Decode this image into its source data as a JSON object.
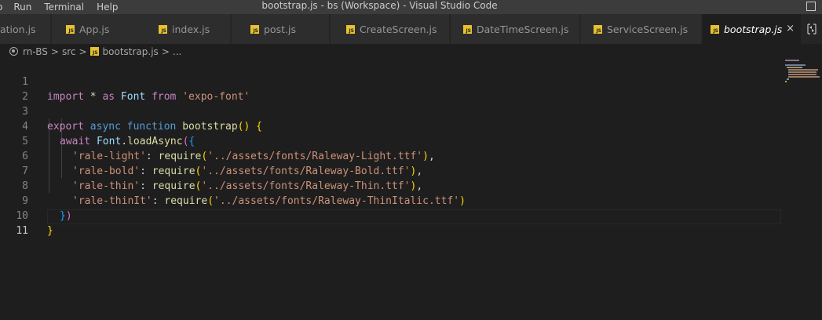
{
  "window": {
    "title": "bootstrap.js - bs (Workspace) - Visual Studio Code",
    "menu": [
      "o",
      "Run",
      "Terminal",
      "Help"
    ]
  },
  "tabs": [
    {
      "label": "ation.js",
      "active": false
    },
    {
      "label": "App.js",
      "active": false
    },
    {
      "label": "index.js",
      "active": false
    },
    {
      "label": "post.js",
      "active": false
    },
    {
      "label": "CreateScreen.js",
      "active": false
    },
    {
      "label": "DateTimeScreen.js",
      "active": false
    },
    {
      "label": "ServiceScreen.js",
      "active": false
    },
    {
      "label": "bootstrap.js",
      "active": true,
      "close": "×"
    }
  ],
  "breadcrumbs": {
    "root": "rn-BS",
    "sep": ">",
    "folder": "src",
    "file": "bootstrap.js",
    "tail": "..."
  },
  "editor": {
    "line_numbers": [
      "1",
      "2",
      "3",
      "4",
      "5",
      "6",
      "7",
      "8",
      "9",
      "10",
      "11"
    ],
    "current_line": 11,
    "l1": {
      "a": "import",
      "b": " * ",
      "c": "as",
      "d": " Font ",
      "e": "from",
      "f": " ",
      "g": "'expo-font'"
    },
    "l3": {
      "a": "export",
      "b": " ",
      "c": "async",
      "d": " ",
      "e": "function",
      "f": " ",
      "g": "bootstrap",
      "h": "()",
      "i": " ",
      "j": "{"
    },
    "l4": {
      "a": "await",
      "b": " ",
      "c": "Font",
      "d": ".",
      "e": "loadAsync",
      "f": "(",
      "g": "{"
    },
    "l5": {
      "a": "'rale-light'",
      "b": ": ",
      "c": "require",
      "d": "(",
      "e": "'../assets/fonts/Raleway-Light.ttf'",
      "f": ")",
      "g": ","
    },
    "l6": {
      "a": "'rale-bold'",
      "b": ": ",
      "c": "require",
      "d": "(",
      "e": "'../assets/fonts/Raleway-Bold.ttf'",
      "f": ")",
      "g": ","
    },
    "l7": {
      "a": "'rale-thin'",
      "b": ": ",
      "c": "require",
      "d": "(",
      "e": "'../assets/fonts/Raleway-Thin.ttf'",
      "f": ")",
      "g": ","
    },
    "l8": {
      "a": "'rale-thinIt'",
      "b": ": ",
      "c": "require",
      "d": "(",
      "e": "'../assets/fonts/Raleway-ThinItalic.ttf'",
      "f": ")"
    },
    "l9": {
      "a": "}",
      "b": ")"
    },
    "l10": {
      "a": "}"
    }
  },
  "icons": {
    "file_icon": "js-file-icon",
    "split_editor": "split-editor-icon",
    "close": "close-icon",
    "workspace_root": "workspace-root-icon"
  },
  "colors": {
    "editor_bg": "#1e1e1e",
    "tab_bar_bg": "#252526",
    "inactive_tab_bg": "#2d2d2d",
    "title_bar_bg": "#3c3c3c",
    "js_icon": "#e8c12e",
    "keyword": "#c586c0",
    "storage": "#569cd6",
    "function": "#dcdcaa",
    "variable": "#9cdcfe",
    "string": "#ce9178"
  }
}
